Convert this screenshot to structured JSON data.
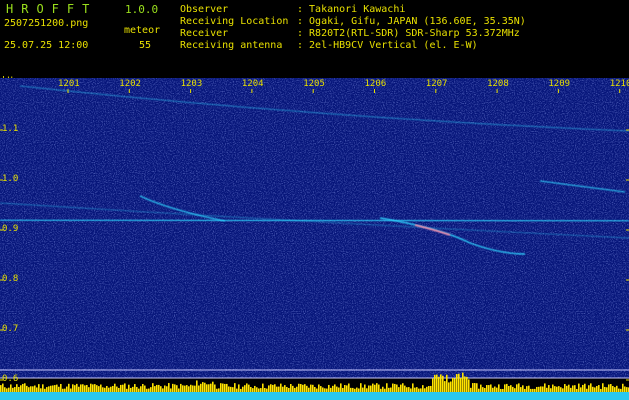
{
  "header": {
    "app_title": "HROFFT",
    "version": "1.0.0",
    "filename": "2507251200.png",
    "datetime": "25.07.25 12:00",
    "meteor_label": "meteor",
    "meteor_count": "55"
  },
  "info": {
    "observer_key": "Observer",
    "observer_val": ": Takanori Kawachi",
    "location_key": "Receiving Location",
    "location_val": ": Ogaki, Gifu, JAPAN (136.60E, 35.35N)",
    "receiver_key": "Receiver",
    "receiver_val": ": R820T2(RTL-SDR) SDR-Sharp 53.372MHz",
    "antenna_key": "Receiving antenna",
    "antenna_val": ": 2el-HB9CV Vertical (el. E-W)"
  },
  "axes": {
    "y_unit": "kHz",
    "time_ticks": [
      "1201",
      "1202",
      "1203",
      "1204",
      "1205",
      "1206",
      "1207",
      "1208",
      "1209",
      "1210"
    ],
    "freq_ticks": [
      "1.1",
      "1.0",
      "0.9",
      "0.8",
      "0.7",
      "0.6"
    ]
  },
  "colors": {
    "background_spectrogram": "#06157a",
    "label": "#e8e000",
    "title": "#9adf1c",
    "signal": "#2fd4ff",
    "meteor_head": "#ff7fa0",
    "activity_bar": "#ffe400",
    "activity_base": "#28c8f0"
  }
}
